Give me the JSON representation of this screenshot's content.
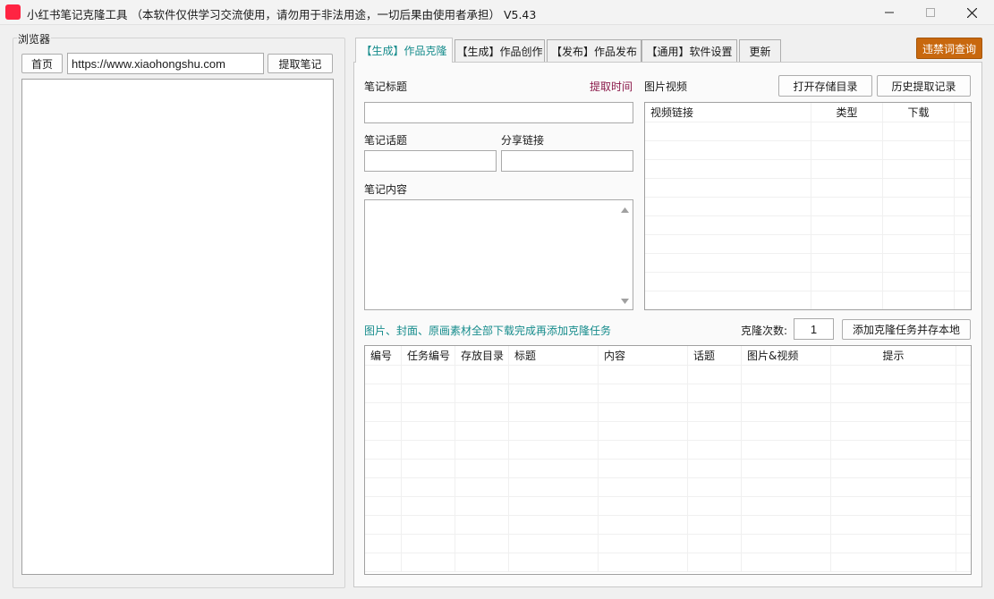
{
  "window": {
    "title": "小红书笔记克隆工具 （本软件仅供学习交流使用，请勿用于非法用途，一切后果由使用者承担）  V5.43",
    "logo_text": "小红书"
  },
  "browser": {
    "legend": "浏览器",
    "home_label": "首页",
    "url": "https://www.xiaohongshu.com",
    "extract_label": "提取笔记"
  },
  "tabs": [
    {
      "label": "【生成】作品克隆"
    },
    {
      "label": "【生成】作品创作"
    },
    {
      "label": "【发布】作品发布"
    },
    {
      "label": "【通用】软件设置"
    },
    {
      "label": "更新"
    }
  ],
  "banned_words_label": "违禁词查询",
  "form": {
    "title_label": "笔记标题",
    "extract_time_label": "提取时间",
    "topic_label": "笔记话题",
    "share_link_label": "分享链接",
    "content_label": "笔记内容",
    "title_value": "",
    "topic_value": "",
    "share_link_value": "",
    "content_value": ""
  },
  "media": {
    "label": "图片视频",
    "open_dir_label": "打开存储目录",
    "history_label": "历史提取记录",
    "columns": [
      "视频链接",
      "类型",
      "下载"
    ]
  },
  "clone": {
    "notice": "图片、封面、原画素材全部下载完成再添加克隆任务",
    "count_label": "克隆次数:",
    "count_value": "1",
    "add_task_label": "添加克隆任务并存本地"
  },
  "tasks": {
    "columns": [
      "编号",
      "任务编号",
      "存放目录",
      "标题",
      "内容",
      "话题",
      "图片&视频",
      "提示"
    ]
  },
  "colors": {
    "accent_teal": "#168c8c",
    "accent_maroon": "#8b1a4a",
    "banned_btn_bg": "#c8680e",
    "logo_red": "#ff2442"
  }
}
